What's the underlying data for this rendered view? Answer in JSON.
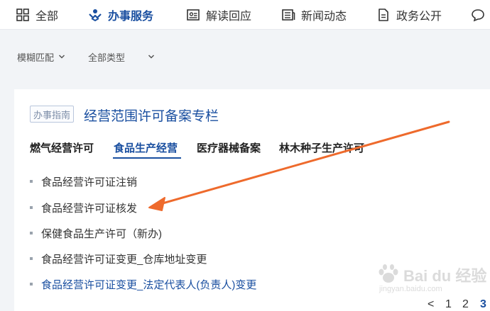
{
  "nav": {
    "items": [
      {
        "label": "全部",
        "icon": "grid-icon"
      },
      {
        "label": "办事服务",
        "icon": "handshake-icon",
        "active": true
      },
      {
        "label": "解读回应",
        "icon": "id-card-icon"
      },
      {
        "label": "新闻动态",
        "icon": "newspaper-icon"
      },
      {
        "label": "政务公开",
        "icon": "document-icon"
      }
    ]
  },
  "filters": {
    "match": "模糊匹配",
    "type": "全部类型"
  },
  "card": {
    "tag": "办事指南",
    "title": "经营范围许可备案专栏",
    "tabs": [
      "燃气经营许可",
      "食品生产经营",
      "医疗器械备案",
      "林木种子生产许可"
    ],
    "active_tab": 1,
    "items": [
      "食品经营许可证注销",
      "食品经营许可证核发",
      "保健食品生产许可（新办)",
      "食品经营许可证变更_仓库地址变更",
      "食品经营许可证变更_法定代表人(负责人)变更"
    ]
  },
  "pager": {
    "prev": "<",
    "pages": [
      "1",
      "2",
      "3"
    ],
    "current": "3"
  },
  "watermark": {
    "brand": "Bai du 经验",
    "url": "jingyan.baidu.com"
  },
  "colors": {
    "accent": "#1a4fa0",
    "arrow": "#ee6a2c",
    "background": "#f2f4f7"
  }
}
